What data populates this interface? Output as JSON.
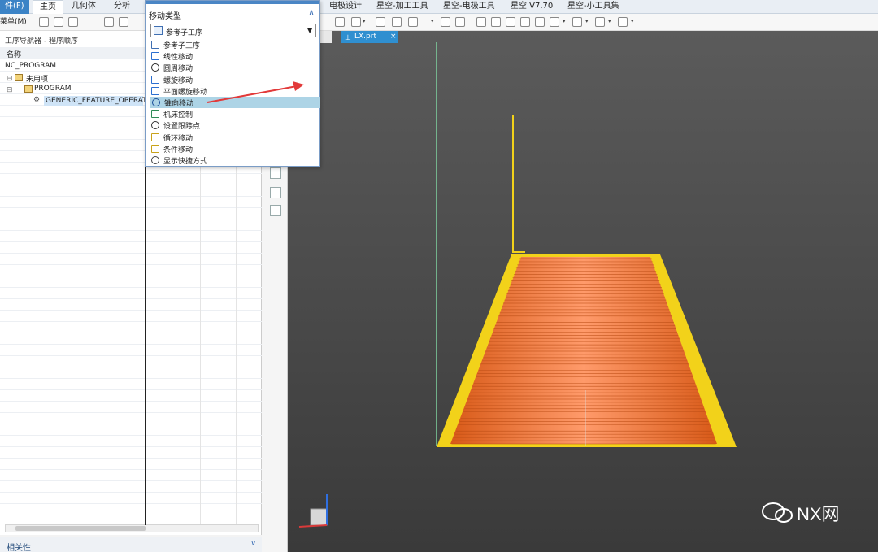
{
  "ribbon": {
    "file_tab": "件(F)",
    "tabs": [
      "主页",
      "几何体",
      "分析"
    ],
    "right_tabs": [
      "电极设计",
      "星空-加工工具",
      "星空-电极工具",
      "星空 V7.70",
      "星空-小工具集"
    ]
  },
  "toolbar": {
    "menu_label": "菜单(M)"
  },
  "navigator": {
    "title": "工序导航器 - 程序顺序",
    "column_name": "名称",
    "tree": [
      {
        "label": "NC_PROGRAM"
      },
      {
        "label": "未用项"
      },
      {
        "label": "PROGRAM"
      },
      {
        "label": "GENERIC_FEATURE_OPERAT..."
      }
    ],
    "bottom_label": "相关性"
  },
  "panel": {
    "title": "移动类型",
    "selected": "参考子工序",
    "options": [
      {
        "label": "参考子工序",
        "icon": "ref-sub-op-icon"
      },
      {
        "label": "线性移动",
        "icon": "linear-move-icon"
      },
      {
        "label": "圆周移动",
        "icon": "circular-move-icon"
      },
      {
        "label": "螺旋移动",
        "icon": "helix-move-icon"
      },
      {
        "label": "平面螺旋移动",
        "icon": "planar-spiral-icon"
      },
      {
        "label": "锥向移动",
        "icon": "conical-move-icon",
        "highlighted": true
      },
      {
        "label": "机床控制",
        "icon": "machine-control-icon"
      },
      {
        "label": "设置跟踪点",
        "icon": "tracking-point-icon"
      },
      {
        "label": "循环移动",
        "icon": "cycle-move-icon"
      },
      {
        "label": "条件移动",
        "icon": "condition-move-icon"
      },
      {
        "label": "显示快捷方式",
        "icon": "show-shortcut-icon"
      }
    ]
  },
  "document": {
    "tab_label": "LX.prt"
  },
  "watermark": {
    "text": "NX网"
  },
  "colors": {
    "accent": "#3b83c6",
    "highlight": "#add4e6",
    "toolpath_yellow": "#f2d21a",
    "toolpath_orange": "#ff7f3f",
    "arrow_red": "#e23a3a"
  }
}
